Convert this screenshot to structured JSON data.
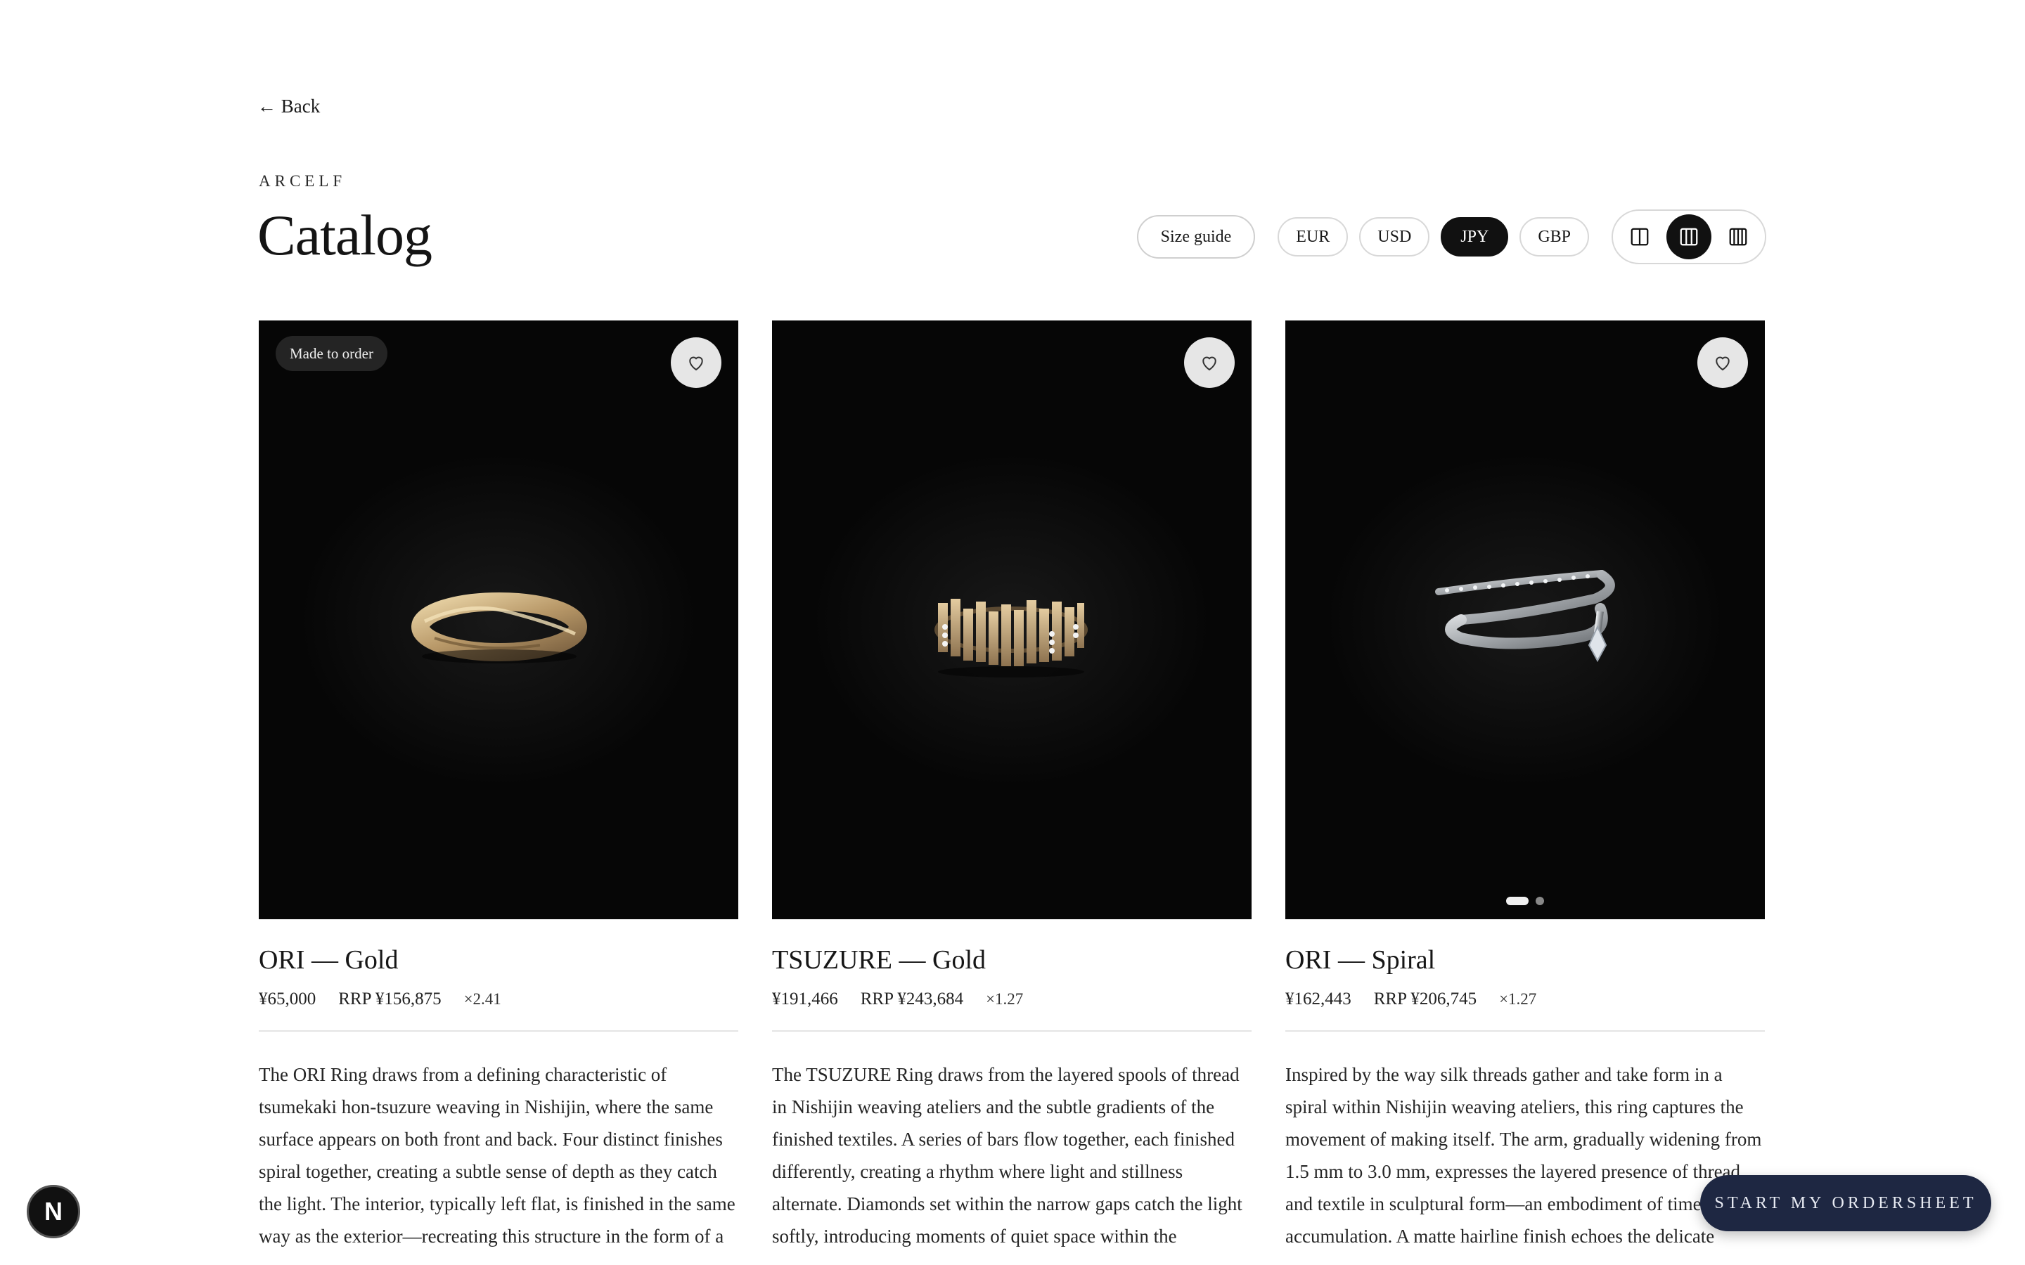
{
  "nav": {
    "back_label": "← Back"
  },
  "header": {
    "brand": "ARCELF",
    "title": "Catalog"
  },
  "controls": {
    "size_guide": "Size guide",
    "currencies": [
      {
        "code": "EUR",
        "active": false
      },
      {
        "code": "USD",
        "active": false
      },
      {
        "code": "JPY",
        "active": true
      },
      {
        "code": "GBP",
        "active": false
      }
    ],
    "layout_options": [
      {
        "icon": "two-column-icon",
        "active": false
      },
      {
        "icon": "three-column-icon",
        "active": true
      },
      {
        "icon": "four-column-icon",
        "active": false
      }
    ]
  },
  "products": [
    {
      "badge": "Made to order",
      "name": "ORI — Gold",
      "price": "¥65,000",
      "rrp": "RRP ¥156,875",
      "multiplier": "×2.41",
      "description": "The ORI Ring draws from a defining characteristic of tsumekaki hon-tsuzure weaving in Nishijin, where the same surface appears on both front and back. Four distinct finishes spiral together, creating a subtle sense of depth as they catch the light. The interior, typically left flat, is finished in the same way as the exterior—recreating this structure in the form of a",
      "image_icon": "gold-twisted-ring",
      "carousel": null
    },
    {
      "badge": "",
      "name": "TSUZURE — Gold",
      "price": "¥191,466",
      "rrp": "RRP ¥243,684",
      "multiplier": "×1.27",
      "description": "The TSUZURE Ring draws from the layered spools of thread in Nishijin weaving ateliers and the subtle gradients of the finished textiles. A series of bars flow together, each finished differently, creating a rhythm where light and stillness alternate. Diamonds set within the narrow gaps catch the light softly, introducing moments of quiet space within the",
      "image_icon": "gold-bar-diamond-ring",
      "carousel": null
    },
    {
      "badge": "",
      "name": "ORI — Spiral",
      "price": "¥162,443",
      "rrp": "RRP ¥206,745",
      "multiplier": "×1.27",
      "description": "Inspired by the way silk threads gather and take form in a spiral within Nishijin weaving ateliers, this ring captures the movement of making itself. The arm, gradually widening from 1.5 mm to 3.0 mm, expresses the layered presence of thread and textile in sculptural form—an embodiment of time and accumulation. A matte hairline finish echoes the delicate",
      "image_icon": "silver-spiral-ring",
      "carousel": {
        "count": 2,
        "active": 0
      }
    }
  ],
  "floating": {
    "logo_letter": "N",
    "order_button": "START MY ORDERSHEET"
  },
  "colors": {
    "accent_dark": "#111111",
    "order_button_bg": "#1e2742",
    "image_bg": "#060606"
  }
}
